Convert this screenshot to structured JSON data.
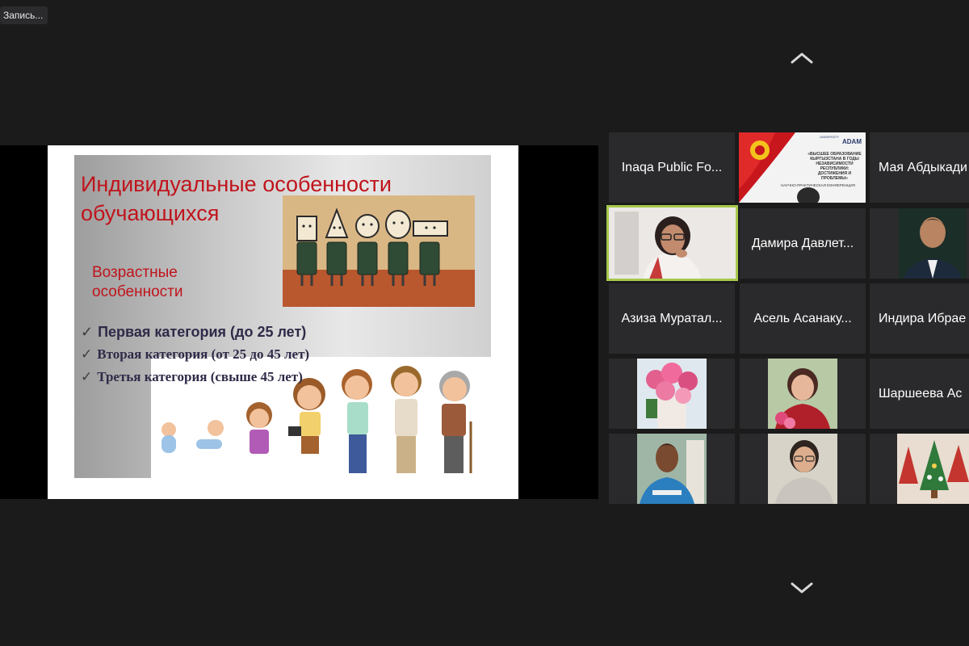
{
  "recording": {
    "label": "Запись..."
  },
  "shared_slide": {
    "title": "Индивидуальные особенности обучающихся",
    "subtitle": "Возрастные особенности",
    "categories": [
      "Первая категория (до 25 лет)",
      "Вторая категория (от 25 до 45 лет)",
      "Третья категория (свыше 45 лет)"
    ]
  },
  "gallery": {
    "participants": [
      {
        "name": "Inaqa Public Fo..."
      },
      {
        "name": "Мая Абдыкади"
      },
      {
        "name": "Дамира Давлет..."
      },
      {
        "name": "Азиза Муратал..."
      },
      {
        "name": "Асель Асанаку..."
      },
      {
        "name": "Индира Ибрае"
      },
      {
        "name": "Шаршеева Ас"
      }
    ],
    "poster": {
      "brand": "ADAM",
      "brand_prefix": "UNIVERSITY",
      "text": "«ВЫСШЕЕ ОБРАЗОВАНИЕ КЫРГЫЗСТАНА В ГОДЫ НЕЗАВИСИМОСТИ РЕСПУБЛИКИ: ДОСТИЖЕНИЯ И ПРОБЛЕМЫ»",
      "footer": "НАУЧНО-ПРАКТИЧЕСКАЯ КОНФЕРЕНЦИЯ"
    }
  },
  "colors": {
    "active_speaker": "#a6c94c",
    "slide_title": "#c0141c"
  }
}
